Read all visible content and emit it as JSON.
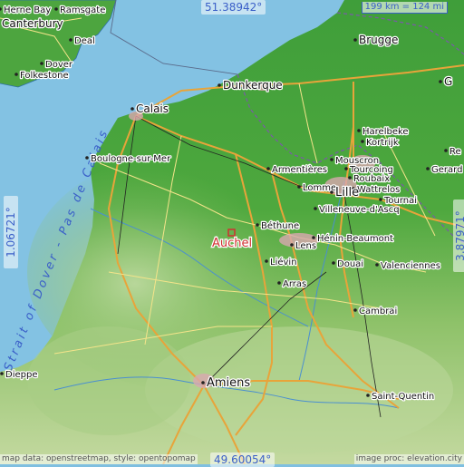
{
  "map": {
    "coords": {
      "top": "51.38942°",
      "bottom": "49.60054°",
      "left": "1.06721°",
      "right": "3.87971°"
    },
    "scale": "199 km = 124 mi",
    "credit_left": "map data: openstreetmap, style: opentopomap",
    "credit_right": "image proc: elevation.city",
    "sea_labels": {
      "strait": "Strait of Dover - Pas de Calais"
    },
    "highlight": "Auchel",
    "cities": [
      {
        "id": "herne-bay",
        "name": "Herne Bay"
      },
      {
        "id": "ramsgate",
        "name": "Ramsgate"
      },
      {
        "id": "canterbury",
        "name": "Canterbury"
      },
      {
        "id": "deal",
        "name": "Deal"
      },
      {
        "id": "dover",
        "name": "Dover"
      },
      {
        "id": "folkestone",
        "name": "Folkestone"
      },
      {
        "id": "calais",
        "name": "Calais"
      },
      {
        "id": "dunkerque",
        "name": "Dunkerque"
      },
      {
        "id": "brugge",
        "name": "Brugge"
      },
      {
        "id": "gent",
        "name": "G"
      },
      {
        "id": "boulogne",
        "name": "Boulogne-sur-Mer"
      },
      {
        "id": "harelbeke",
        "name": "Harelbeke"
      },
      {
        "id": "kortrijk",
        "name": "Kortrijk"
      },
      {
        "id": "mouscron",
        "name": "Mouscron"
      },
      {
        "id": "tourcoing",
        "name": "Tourcoing"
      },
      {
        "id": "roubaix",
        "name": "Roubaix"
      },
      {
        "id": "wattrelos",
        "name": "Wattrelos"
      },
      {
        "id": "armentieres",
        "name": "Armentières"
      },
      {
        "id": "lomme",
        "name": "Lomme"
      },
      {
        "id": "lille",
        "name": "Lille"
      },
      {
        "id": "tournai",
        "name": "Tournai"
      },
      {
        "id": "villeneuve",
        "name": "Villeneuve-d'Ascq"
      },
      {
        "id": "bethune",
        "name": "Béthune"
      },
      {
        "id": "lens",
        "name": "Lens"
      },
      {
        "id": "henin",
        "name": "Hénin-Beaumont"
      },
      {
        "id": "lievin",
        "name": "Liévin"
      },
      {
        "id": "douai",
        "name": "Douai"
      },
      {
        "id": "arras",
        "name": "Arras"
      },
      {
        "id": "valenciennes",
        "name": "Valenciennes"
      },
      {
        "id": "cambrai",
        "name": "Cambrai"
      },
      {
        "id": "amiens",
        "name": "Amiens"
      },
      {
        "id": "saint-quentin",
        "name": "Saint-Quentin"
      },
      {
        "id": "dieppe",
        "name": "Dieppe"
      },
      {
        "id": "renaix",
        "name": "Re"
      },
      {
        "id": "geraardsbergen",
        "name": "Gerard"
      }
    ]
  }
}
